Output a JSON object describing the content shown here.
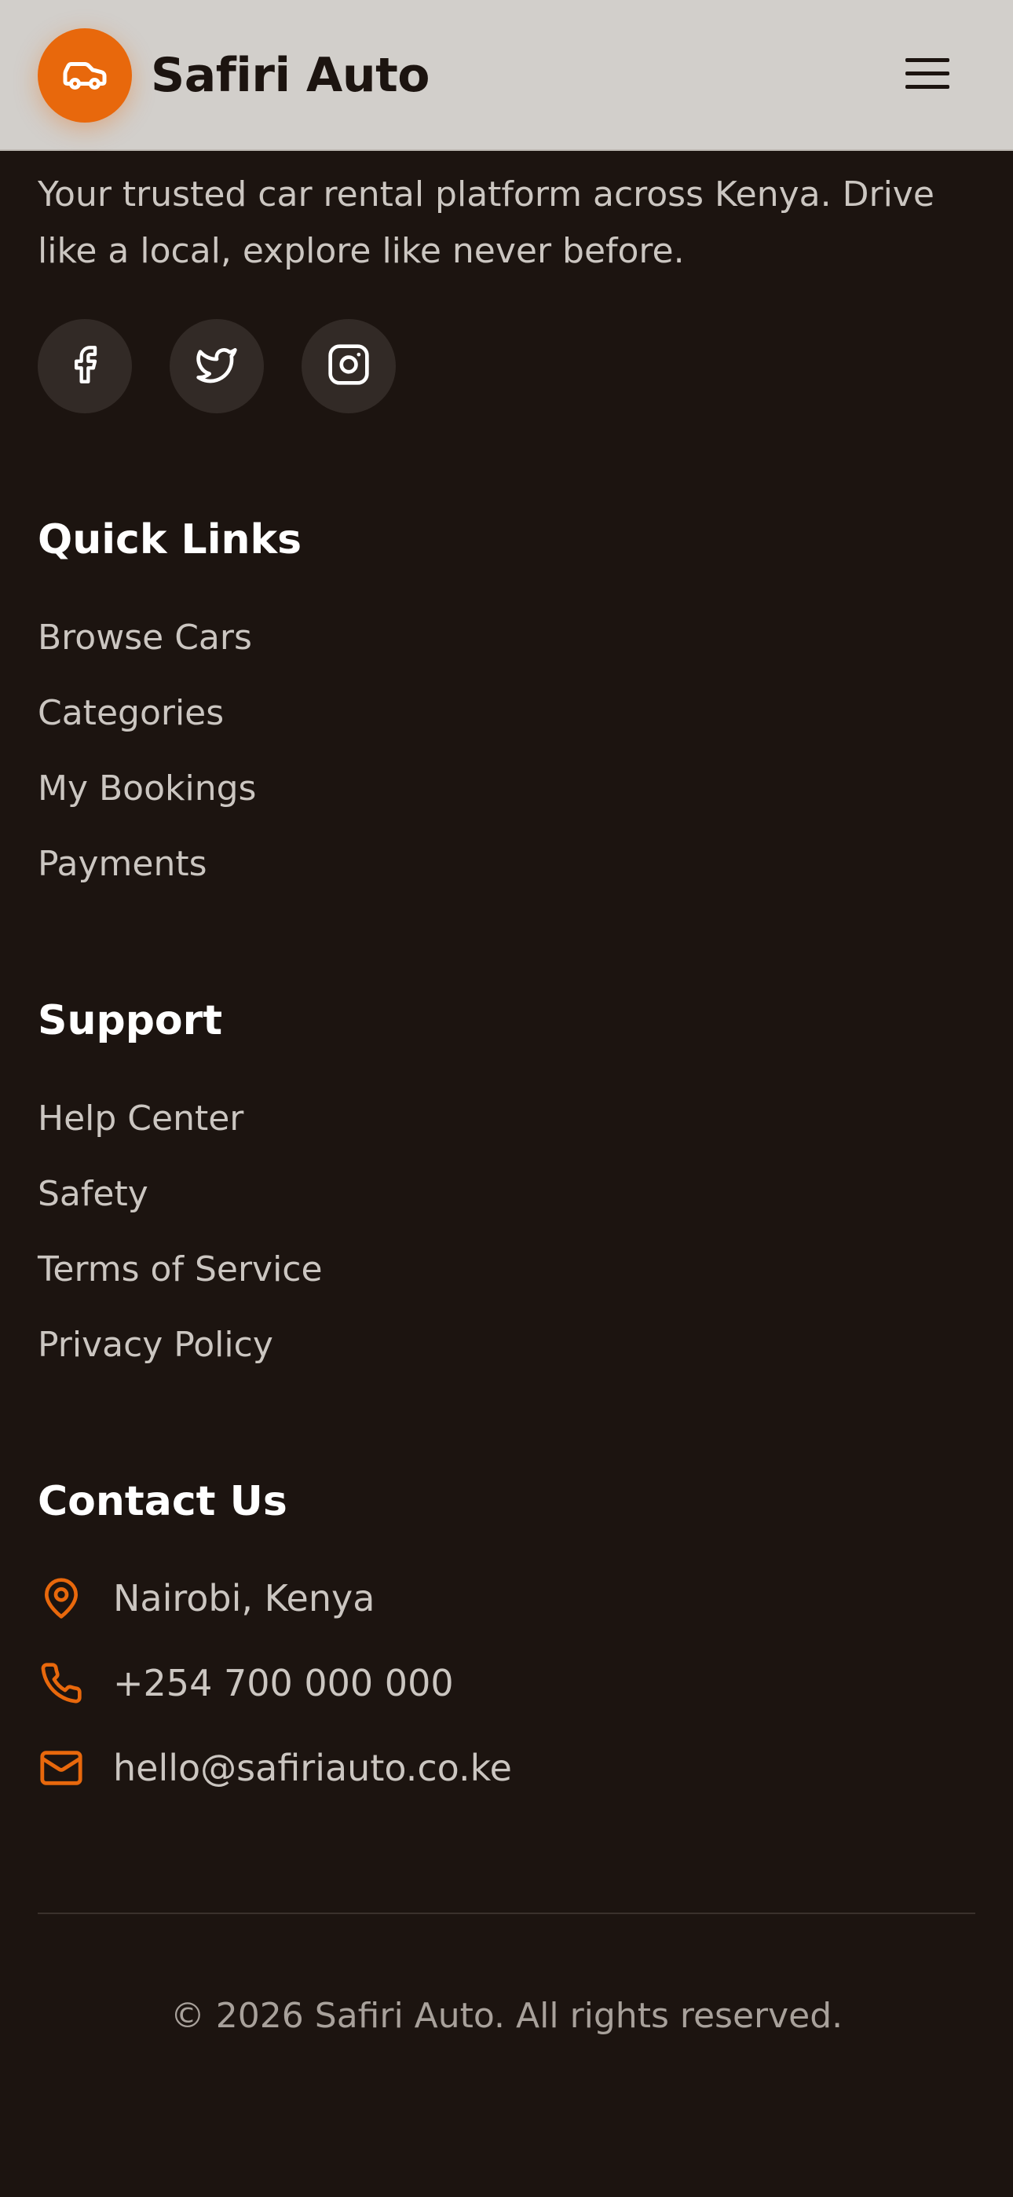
{
  "header": {
    "brand": "Safiri Auto",
    "logo_icon": "car-icon",
    "menu_icon": "hamburger-menu-icon"
  },
  "footer": {
    "tagline": "Your trusted car rental platform across Kenya. Drive like a local, explore like never before.",
    "socials": [
      {
        "icon": "facebook-icon"
      },
      {
        "icon": "twitter-icon"
      },
      {
        "icon": "instagram-icon"
      }
    ],
    "quick_links": {
      "title": "Quick Links",
      "items": [
        "Browse Cars",
        "Categories",
        "My Bookings",
        "Payments"
      ]
    },
    "support": {
      "title": "Support",
      "items": [
        "Help Center",
        "Safety",
        "Terms of Service",
        "Privacy Policy"
      ]
    },
    "contact": {
      "title": "Contact Us",
      "items": [
        {
          "icon": "map-pin-icon",
          "text": "Nairobi, Kenya"
        },
        {
          "icon": "phone-icon",
          "text": "+254 700 000 000"
        },
        {
          "icon": "mail-icon",
          "text": "hello@safiriauto.co.ke"
        }
      ]
    },
    "copyright": "© 2026 Safiri Auto. All rights reserved."
  },
  "colors": {
    "accent": "#e8680c",
    "header_bg": "#d2cfcb",
    "footer_bg": "#1c1410",
    "muted_text": "#cbc6c1"
  }
}
